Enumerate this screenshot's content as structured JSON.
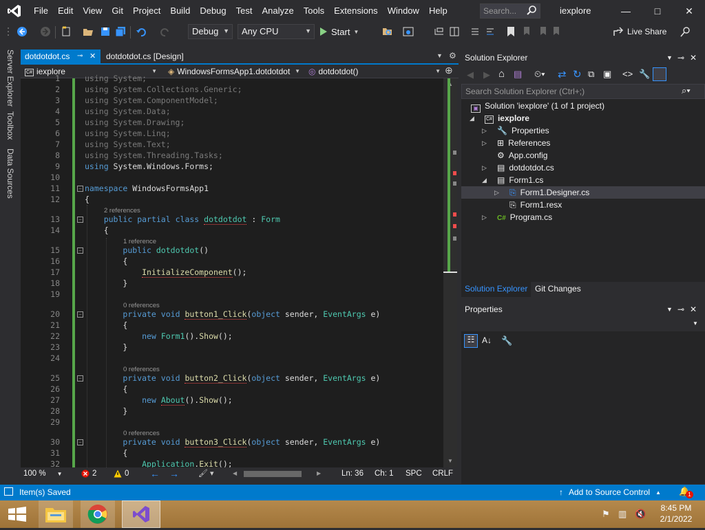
{
  "menubar": {
    "logo_icon": "visual-studio-logo-icon",
    "items": [
      "File",
      "Edit",
      "View",
      "Git",
      "Project",
      "Build",
      "Debug",
      "Test",
      "Analyze",
      "Tools",
      "Extensions",
      "Window",
      "Help"
    ],
    "search_placeholder": "Search...",
    "window_title": "iexplore",
    "controls": {
      "minimize": "—",
      "maximize": "□",
      "close": "✕"
    }
  },
  "toolbar": {
    "configuration": "Debug",
    "platform": "Any CPU",
    "start_label": "Start",
    "live_share_label": "Live Share"
  },
  "side_tabs": [
    "Server Explorer",
    "Toolbox",
    "Data Sources"
  ],
  "document_tabs": {
    "active": "dotdotdot.cs",
    "pin_glyph": "⊸",
    "close_glyph": "✕",
    "second": "dotdotdot.cs [Design]"
  },
  "navigation": {
    "project": "iexplore",
    "class": "WindowsFormsApp1.dotdotdot",
    "member": "dotdotdot()"
  },
  "code": {
    "lines": [
      {
        "n": "1",
        "html": "<span class='dim'>using System;</span>"
      },
      {
        "n": "2",
        "html": "<span class='dim'>using</span> <span class='dim'>System.Collections.Generic;</span>"
      },
      {
        "n": "3",
        "html": "<span class='dim'>using System.ComponentModel;</span>"
      },
      {
        "n": "4",
        "html": "<span class='dim'>using System.Data;</span>"
      },
      {
        "n": "5",
        "html": "<span class='dim'>using System.Drawing;</span>"
      },
      {
        "n": "6",
        "html": "<span class='dim'>using System.Linq;</span>"
      },
      {
        "n": "7",
        "html": "<span class='dim'>using System.Text;</span>"
      },
      {
        "n": "8",
        "html": "<span class='dim'>using System.Threading.Tasks;</span>"
      },
      {
        "n": "9",
        "html": "<span class='kw'>using</span> System.Windows.Forms;"
      },
      {
        "n": "10",
        "html": ""
      },
      {
        "n": "11",
        "html": "<span class='kw'>namespace</span> WindowsFormsApp1"
      },
      {
        "n": "12",
        "html": "{"
      },
      {
        "n": "13",
        "html": "    <span class='kw'>public</span> <span class='kw'>partial</span> <span class='kw'>class</span> <span class='ty sq'>dotdotdot</span> : <span class='ty'>Form</span>"
      },
      {
        "n": "14",
        "html": "    {"
      },
      {
        "n": "15",
        "html": "        <span class='kw'>public</span> <span class='ty'>dotdotdot</span>()"
      },
      {
        "n": "16",
        "html": "        {"
      },
      {
        "n": "17",
        "html": "            <span class='fn sq'>InitializeComponent</span>();"
      },
      {
        "n": "18",
        "html": "        }"
      },
      {
        "n": "19",
        "html": ""
      },
      {
        "n": "20",
        "html": "        <span class='kw'>private</span> <span class='kw'>void</span> <span class='fn sq'>button1_Click</span>(<span class='kw'>object</span> sender, <span class='ty'>EventArgs</span> e)"
      },
      {
        "n": "21",
        "html": "        {"
      },
      {
        "n": "22",
        "html": "            <span class='kw'>new</span> <span class='ty'>Form1</span>().<span class='fn'>Show</span>();"
      },
      {
        "n": "23",
        "html": "        }"
      },
      {
        "n": "24",
        "html": ""
      },
      {
        "n": "25",
        "html": "        <span class='kw'>private</span> <span class='kw'>void</span> <span class='fn sq'>button2_Click</span>(<span class='kw'>object</span> sender, <span class='ty'>EventArgs</span> e)"
      },
      {
        "n": "26",
        "html": "        {"
      },
      {
        "n": "27",
        "html": "            <span class='kw'>new</span> <span class='ty sq'>About</span>().<span class='fn'>Show</span>();"
      },
      {
        "n": "28",
        "html": "        }"
      },
      {
        "n": "29",
        "html": ""
      },
      {
        "n": "30",
        "html": "        <span class='kw'>private</span> <span class='kw'>void</span> <span class='fn sq'>button3_Click</span>(<span class='kw'>object</span> sender, <span class='ty'>EventArgs</span> e)"
      },
      {
        "n": "31",
        "html": "        {"
      },
      {
        "n": "32",
        "html": "            <span class='ty'>Application</span>.<span class='fn'>Exit</span>();"
      }
    ],
    "codelens": [
      "2 references",
      "1 reference",
      "0 references",
      "0 references",
      "0 references"
    ]
  },
  "editor_status": {
    "zoom": "100 %",
    "errors": "2",
    "warnings": "0",
    "line": "Ln: 36",
    "col": "Ch: 1",
    "whitespace": "SPC",
    "line_ending": "CRLF"
  },
  "solution_explorer": {
    "title": "Solution Explorer",
    "search_placeholder": "Search Solution Explorer (Ctrl+;)",
    "solution_label": "Solution 'iexplore' (1 of 1 project)",
    "project": "iexplore",
    "items": [
      "Properties",
      "References",
      "App.config",
      "dotdotdot.cs",
      "Form1.cs",
      "Form1.Designer.cs",
      "Form1.resx",
      "Program.cs"
    ],
    "bottom_tabs": [
      "Solution Explorer",
      "Git Changes"
    ]
  },
  "properties": {
    "title": "Properties"
  },
  "statusbar": {
    "message": "Item(s) Saved",
    "source_control": "Add to Source Control",
    "notification_count": "1"
  },
  "taskbar": {
    "time": "8:45 PM",
    "date": "2/1/2022"
  },
  "colors": {
    "accent": "#007acc",
    "editor_bg": "#1e1e1e",
    "chrome_bg": "#2d2d30",
    "keyword": "#569cd6",
    "type": "#4ec9b0",
    "method": "#dcdcaa"
  }
}
